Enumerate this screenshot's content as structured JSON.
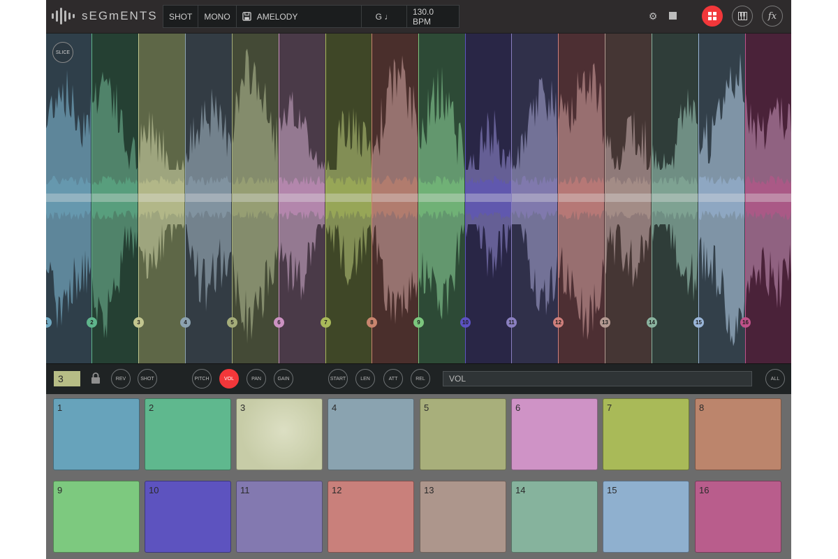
{
  "app": {
    "name": "sEGmENTS",
    "accent": "#f2373a"
  },
  "topbar": {
    "mode": "SHOT",
    "channels": "MONO",
    "preset": "AMELODY",
    "key": "G ♩",
    "tempo": "130.0 BPM",
    "icons": [
      "settings-icon",
      "stop-icon",
      "grid-view-icon",
      "keyboard-icon",
      "fx-icon"
    ],
    "fx_label": "fx"
  },
  "waveform": {
    "slice_button": "SLICE",
    "slices": [
      {
        "n": "1",
        "bg": "#2f3f4a",
        "wave": "#6f9fb5",
        "dot": "#6ea7c0"
      },
      {
        "n": "2",
        "bg": "#254033",
        "wave": "#5f9a7e",
        "dot": "#5fb58c"
      },
      {
        "n": "3",
        "bg": "#5e6747",
        "wave": "#b4b990",
        "dot": "#c2c68f"
      },
      {
        "n": "4",
        "bg": "#333c44",
        "wave": "#8a9aa6",
        "dot": "#8ca2b0"
      },
      {
        "n": "5",
        "bg": "#444a36",
        "wave": "#9aa37f",
        "dot": "#a5ad7a"
      },
      {
        "n": "6",
        "bg": "#4a3a48",
        "wave": "#ad8fa9",
        "dot": "#cc92c2"
      },
      {
        "n": "7",
        "bg": "#3f4727",
        "wave": "#9aa665",
        "dot": "#a9b95a"
      },
      {
        "n": "8",
        "bg": "#4a2f2c",
        "wave": "#b08a85",
        "dot": "#c9856e"
      },
      {
        "n": "9",
        "bg": "#2d4a36",
        "wave": "#75b182",
        "dot": "#7cc77e"
      },
      {
        "n": "10",
        "bg": "#292646",
        "wave": "#7a73b0",
        "dot": "#5c52c2"
      },
      {
        "n": "11",
        "bg": "#30304a",
        "wave": "#8a88b2",
        "dot": "#8a7fc0"
      },
      {
        "n": "12",
        "bg": "#4d2f33",
        "wave": "#b18585",
        "dot": "#cf7f7c"
      },
      {
        "n": "13",
        "bg": "#453634",
        "wave": "#a89290",
        "dot": "#b49a92"
      },
      {
        "n": "14",
        "bg": "#2f3d39",
        "wave": "#86a99c",
        "dot": "#8ab39f"
      },
      {
        "n": "15",
        "bg": "#33404a",
        "wave": "#9ab0c6",
        "dot": "#9ab6d8"
      },
      {
        "n": "16",
        "bg": "#4a2239",
        "wave": "#a8789a",
        "dot": "#c0528a"
      }
    ]
  },
  "controls": {
    "selected_slot": "3",
    "buttons": [
      "REV",
      "SHOT",
      "PITCH",
      "VOL",
      "PAN",
      "GAIN",
      "START",
      "LEN",
      "ATT",
      "REL",
      "ALL"
    ],
    "active": "VOL",
    "param_label": "VOL"
  },
  "pads": [
    {
      "n": "1",
      "color": "#67a3bb"
    },
    {
      "n": "2",
      "color": "#5fb88e"
    },
    {
      "n": "3",
      "color": "#c7cca7"
    },
    {
      "n": "4",
      "color": "#8aa3b0"
    },
    {
      "n": "5",
      "color": "#a8af7b"
    },
    {
      "n": "6",
      "color": "#cf93c6"
    },
    {
      "n": "7",
      "color": "#a9ba58"
    },
    {
      "n": "8",
      "color": "#bc856c"
    },
    {
      "n": "9",
      "color": "#7dc97f"
    },
    {
      "n": "10",
      "color": "#5d53bf"
    },
    {
      "n": "11",
      "color": "#8379b0"
    },
    {
      "n": "12",
      "color": "#c9807b"
    },
    {
      "n": "13",
      "color": "#ad968c"
    },
    {
      "n": "14",
      "color": "#86b39d"
    },
    {
      "n": "15",
      "color": "#8fb0cf"
    },
    {
      "n": "16",
      "color": "#b95d8c"
    }
  ]
}
